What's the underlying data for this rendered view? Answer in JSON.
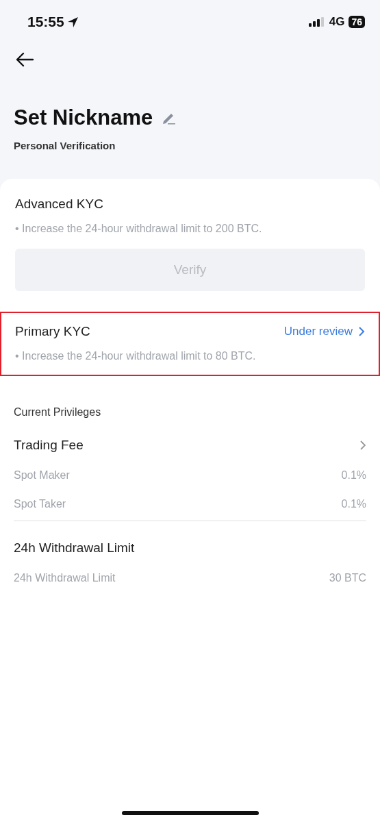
{
  "status_bar": {
    "time": "15:55",
    "network": "4G",
    "battery": "76"
  },
  "header": {
    "title": "Set Nickname",
    "subtitle": "Personal Verification"
  },
  "kyc_levels": [
    {
      "title": "Advanced KYC",
      "description": "• Increase the 24-hour withdrawal limit to 200 BTC.",
      "button": {
        "label": "Verify",
        "disabled": true
      },
      "highlighted": false
    },
    {
      "title": "Primary KYC",
      "status": "Under review",
      "description": "• Increase the 24-hour withdrawal limit to 80 BTC.",
      "highlighted": true
    }
  ],
  "privileges": {
    "heading": "Current Privileges",
    "groups": [
      {
        "title": "Trading Fee",
        "has_chevron": true,
        "rows": [
          {
            "label": "Spot Maker",
            "value": "0.1%"
          },
          {
            "label": "Spot Taker",
            "value": "0.1%"
          }
        ]
      },
      {
        "title": "24h Withdrawal Limit",
        "has_chevron": false,
        "rows": [
          {
            "label": "24h Withdrawal Limit",
            "value": "30 BTC"
          }
        ]
      }
    ]
  }
}
